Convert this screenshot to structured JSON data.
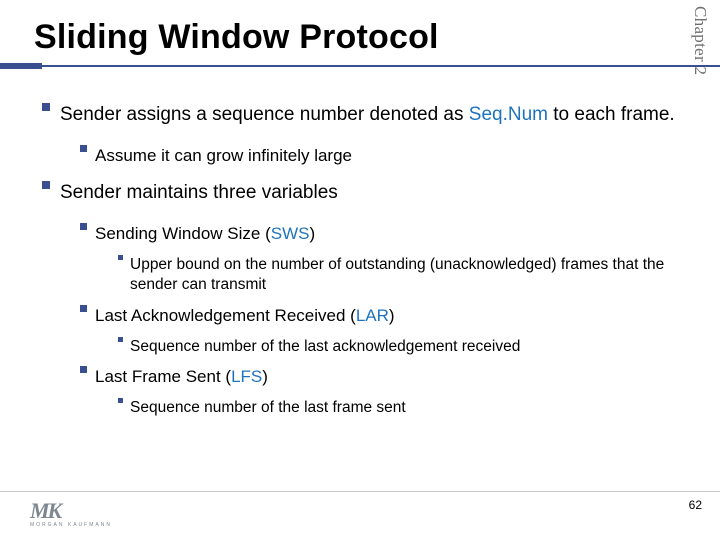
{
  "chapter": "Chapter 2",
  "title": "Sliding Window Protocol",
  "points": {
    "p1_pre": "Sender assigns a sequence number denoted as ",
    "p1_accent": "Seq.Num",
    "p1_post": " to each frame.",
    "p1a": "Assume it can grow infinitely large",
    "p2": "Sender maintains three variables",
    "p2a_pre": "Sending Window Size (",
    "p2a_accent": "SWS",
    "p2a_post": ")",
    "p2a_i": "Upper bound on the number of outstanding (unacknowledged) frames that the sender can transmit",
    "p2b_pre": "Last Acknowledgement Received (",
    "p2b_accent": "LAR",
    "p2b_post": ")",
    "p2b_i": "Sequence number of the last acknowledgement received",
    "p2c_pre": "Last Frame Sent (",
    "p2c_accent": "LFS",
    "p2c_post": ")",
    "p2c_i": "Sequence number of the last frame sent"
  },
  "logo": {
    "initials": "MK",
    "publisher": "MORGAN KAUFMANN"
  },
  "page": "62"
}
